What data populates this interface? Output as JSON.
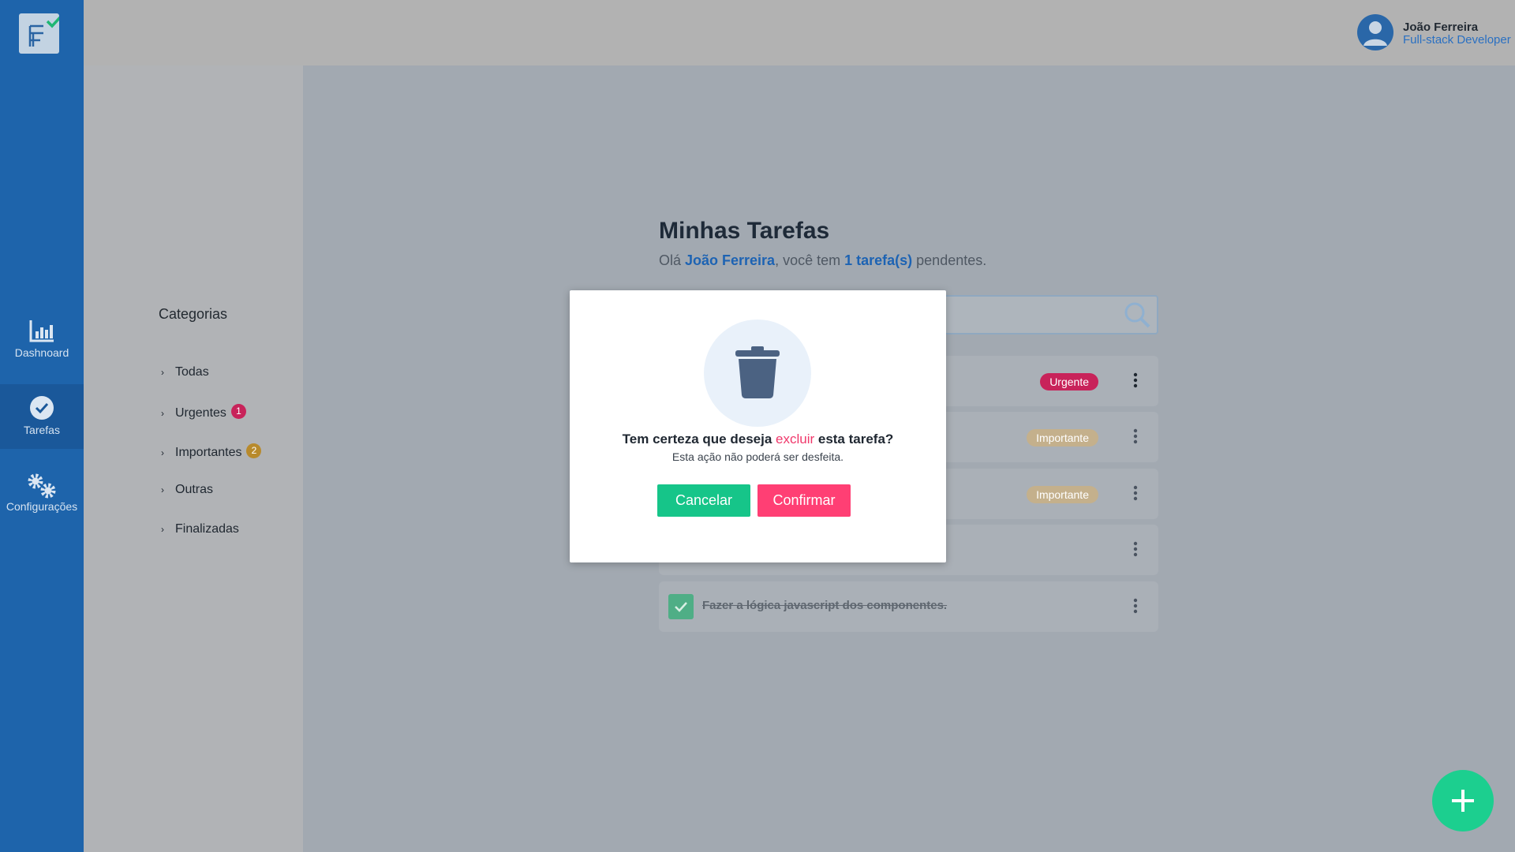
{
  "sidebar": {
    "items": [
      {
        "label": "Dashnoard",
        "icon": "bar-chart-icon"
      },
      {
        "label": "Tarefas",
        "icon": "check-circle-icon",
        "active": true
      },
      {
        "label": "Configurações",
        "icon": "gears-icon"
      }
    ]
  },
  "header": {
    "user_name": "João Ferreira",
    "user_role": "Full-stack Developer"
  },
  "categories": {
    "title": "Categorias",
    "items": [
      {
        "label": "Todas"
      },
      {
        "label": "Urgentes",
        "count": "1"
      },
      {
        "label": "Importantes",
        "count": "2"
      },
      {
        "label": "Outras"
      },
      {
        "label": "Finalizadas"
      }
    ]
  },
  "main": {
    "title": "Minhas Tarefas",
    "subtitle_prefix": "Olá ",
    "subtitle_name": "João Ferreira",
    "subtitle_mid": ", você tem ",
    "subtitle_count": "1 tarefa(s)",
    "subtitle_suffix": " pendentes.",
    "tasks": [
      {
        "tag": "Urgente"
      },
      {
        "tag": "Importante"
      },
      {
        "tag": "Importante"
      },
      {
        "tag": ""
      },
      {
        "tag": "",
        "text": "Fazer a lógica javascript dos componentes.",
        "done": true
      }
    ]
  },
  "modal": {
    "question_prefix": "Tem certeza que deseja ",
    "question_action": "excluir",
    "question_suffix": " esta tarefa?",
    "note": "Esta ação não poderá ser desfeita.",
    "cancel_label": "Cancelar",
    "confirm_label": "Confirmar"
  },
  "colors": {
    "sidebar": "#1e64ab",
    "urgent": "#c8235a",
    "important": "#d6b37a",
    "cancel": "#16c589",
    "confirm": "#ff3f74",
    "fab": "#1ccf8f"
  }
}
